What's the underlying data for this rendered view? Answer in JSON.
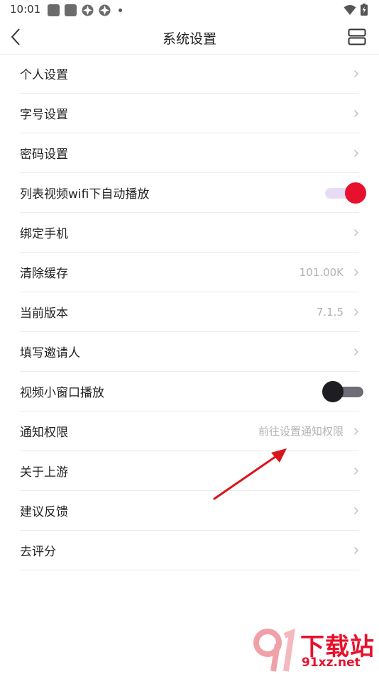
{
  "status_bar": {
    "time": "10:01",
    "icons": [
      "square-icon",
      "square-icon",
      "app-icon",
      "app-icon",
      "dot-icon"
    ],
    "right_icons": [
      "wifi-icon",
      "battery-charging-icon"
    ]
  },
  "header": {
    "title": "系统设置",
    "back_icon": "chevron-left-icon",
    "right_icon": "layout-icon"
  },
  "settings": [
    {
      "label": "个人设置",
      "value": "",
      "control": "chevron"
    },
    {
      "label": "字号设置",
      "value": "",
      "control": "chevron"
    },
    {
      "label": "密码设置",
      "value": "",
      "control": "chevron"
    },
    {
      "label": "列表视频wifi下自动播放",
      "value": "",
      "control": "toggle",
      "on": true
    },
    {
      "label": "绑定手机",
      "value": "",
      "control": "chevron"
    },
    {
      "label": "清除缓存",
      "value": "101.00K",
      "control": "chevron"
    },
    {
      "label": "当前版本",
      "value": "7.1.5",
      "control": "chevron"
    },
    {
      "label": "填写邀请人",
      "value": "",
      "control": "chevron"
    },
    {
      "label": "视频小窗口播放",
      "value": "",
      "control": "toggle",
      "on": false
    },
    {
      "label": "通知权限",
      "value": "前往设置通知权限",
      "control": "chevron"
    },
    {
      "label": "关于上游",
      "value": "",
      "control": "chevron"
    },
    {
      "label": "建议反馈",
      "value": "",
      "control": "chevron"
    },
    {
      "label": "去评分",
      "value": "",
      "control": "chevron"
    }
  ],
  "colors": {
    "accent": "#e8112d",
    "toggle_on_track": "#e7dbf5",
    "toggle_off_knob": "#1d1d22",
    "toggle_off_track": "#6e6e78",
    "value_text": "#b3b3b3"
  },
  "annotation": {
    "icon": "red-arrow-icon"
  },
  "watermark": {
    "title": "下载站",
    "url": "91xz.net",
    "logo_icon": "91-logo-icon"
  }
}
